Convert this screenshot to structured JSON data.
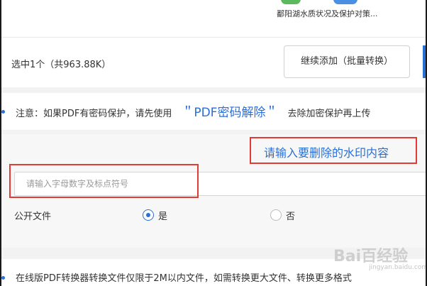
{
  "file": {
    "name": "鄱阳湖水质状况及保护对策..."
  },
  "action_bar": {
    "selection_info": "选中1个（共963.88K）",
    "continue_button": "继续添加（批量转换）"
  },
  "notice": {
    "prefix": "注意：如果PDF有密码保护，请先使用",
    "link": "＂PDF密码解除＂",
    "suffix": "去除加密保护再上传"
  },
  "watermark": {
    "title": "请输入要删除的水印内容",
    "input_placeholder": "请输入字母数字及标点符号",
    "input_value": ""
  },
  "public_file": {
    "label": "公开文件",
    "options": [
      {
        "label": "是",
        "checked": true
      },
      {
        "label": "否",
        "checked": false
      }
    ]
  },
  "bottom_info": {
    "text": "在线版PDF转换器转换文件仅限于2M以内文件，如需转换更大文件、转换更多格式"
  },
  "overlay": {
    "brand": "Bai百经验",
    "sub": "jingyan.baidu.com"
  },
  "colors": {
    "accent": "#2a6fd6",
    "highlight_box": "#e53935"
  }
}
